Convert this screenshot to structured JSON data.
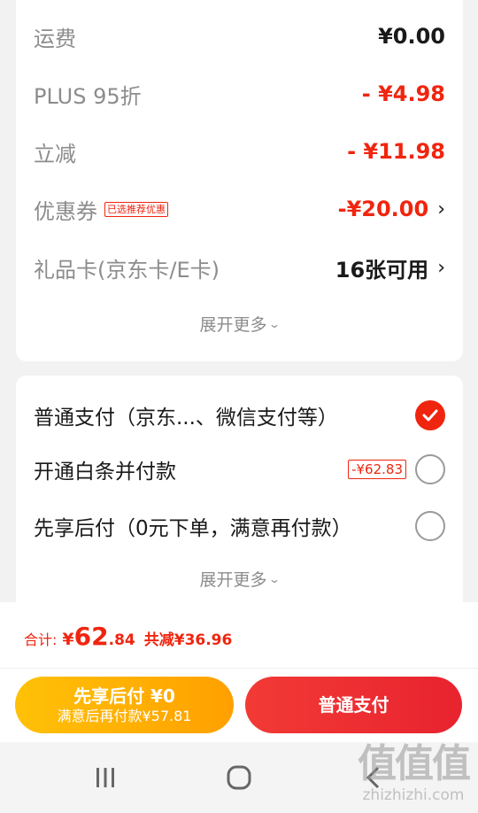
{
  "summary": {
    "rows": [
      {
        "label": "运费",
        "value": "¥0.00"
      },
      {
        "label": "PLUS 95折",
        "value": "- ¥4.98"
      },
      {
        "label": "立减",
        "value": "- ¥11.98"
      },
      {
        "label": "优惠券",
        "tag": "已选推荐优惠",
        "value": "-¥20.00",
        "chevron": "›"
      },
      {
        "label": "礼品卡(京东卡/E卡)",
        "value": "16张可用",
        "chevron": "›"
      }
    ],
    "expand_label": "展开更多",
    "expand_caret": "⌄"
  },
  "payment": {
    "options": [
      {
        "label": "普通支付（京东...、微信支付等）",
        "selected": true
      },
      {
        "label": "开通白条并付款",
        "tag": "-¥62.83",
        "selected": false
      },
      {
        "label": "先享后付（0元下单，满意再付款）",
        "selected": false
      }
    ],
    "expand_label": "展开更多",
    "expand_caret": "⌄"
  },
  "footer": {
    "total_label": "合计:",
    "currency": "¥",
    "total_int": "62",
    "total_dec": ".84",
    "savings": "共减¥36.96",
    "later_pay_label": "先享后付 ¥0",
    "later_pay_sub": "满意后再付款¥57.81",
    "normal_pay_label": "普通支付"
  },
  "navbar": {
    "icons": [
      "recent-apps-icon",
      "home-icon",
      "back-icon"
    ]
  },
  "watermark": {
    "logo": "值值值",
    "url": "zhizhizhi.com"
  },
  "colors": {
    "accent_red": "#f0250f",
    "pay_yellow": "#ffb300",
    "pay_red": "#ed2e33"
  }
}
